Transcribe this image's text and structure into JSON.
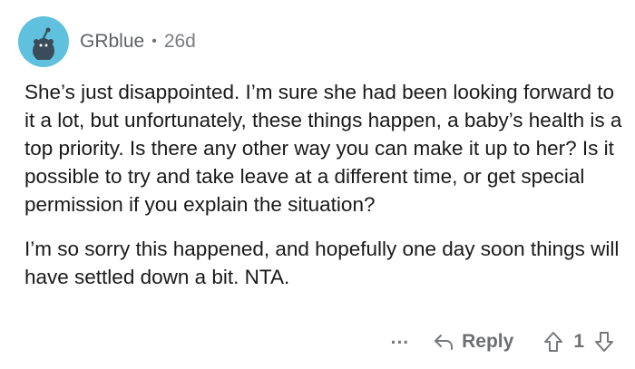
{
  "comment": {
    "username": "GRblue",
    "separator": "•",
    "age": "26d",
    "paragraphs": [
      "She’s just disappointed. I’m sure she had been looking forward to it a lot, but unfortunately, these things happen, a baby’s health is a top priority. Is there any other way you can make it up to her? Is it possible to try and take leave at a different time, or get special permission if you explain the situation?",
      "I’m so sorry this happened, and hopefully one day soon things will have settled down a bit. NTA."
    ],
    "actions": {
      "more_label": "...",
      "reply_label": "Reply",
      "vote_count": "1"
    }
  },
  "colors": {
    "avatar_bg": "#5fc1dd",
    "meta_text": "#6d6f72",
    "body_text": "#1a1a1b"
  },
  "icons": {
    "avatar": "snoo-avatar-icon",
    "reply": "reply-arrow-icon",
    "upvote": "upvote-arrow-icon",
    "downvote": "downvote-arrow-icon"
  }
}
